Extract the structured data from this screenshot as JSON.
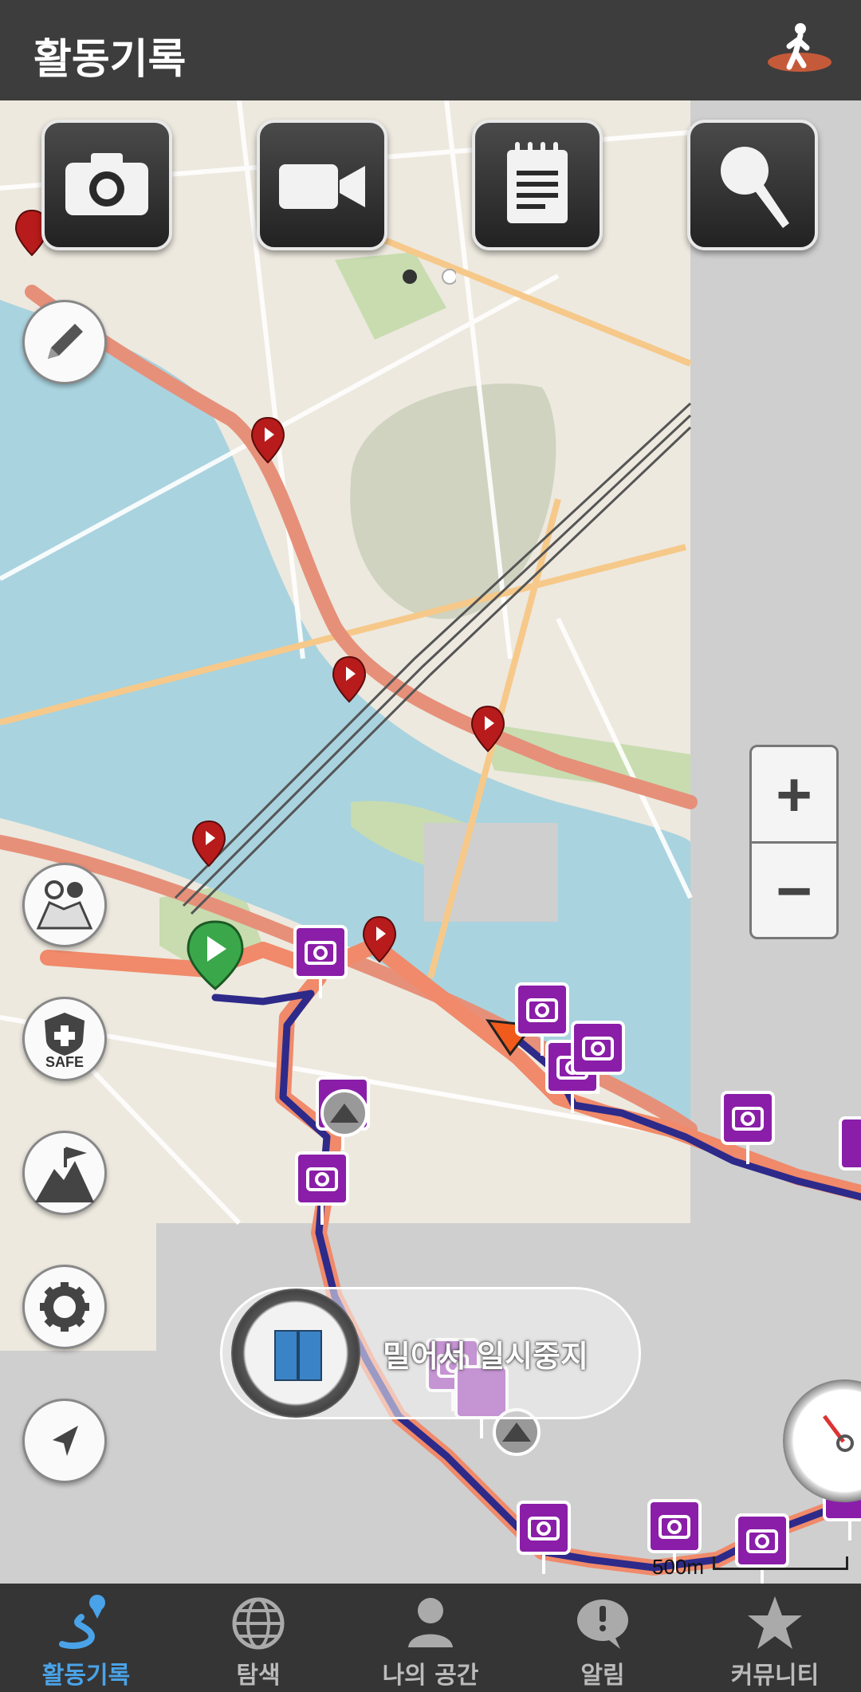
{
  "header": {
    "title": "활동기록",
    "activity_icon": "walker-icon"
  },
  "media_buttons": [
    {
      "name": "camera-button",
      "icon": "camera-icon"
    },
    {
      "name": "video-button",
      "icon": "video-camera-icon"
    },
    {
      "name": "memo-button",
      "icon": "notepad-icon"
    },
    {
      "name": "voice-button",
      "icon": "microphone-icon"
    }
  ],
  "map": {
    "zoom_in_label": "+",
    "zoom_out_label": "−",
    "scale_label": "500m",
    "pause_slider_label": "밀어서 일시중지",
    "colors": {
      "water": "#a9d3df",
      "land": "#ede9df",
      "park": "#c8dcb0",
      "track": "#2d2a8a",
      "track_halo": "#f08a6a",
      "photo_pin": "#8a1ea8",
      "marker": "#b81b1b"
    }
  },
  "side_buttons": [
    {
      "name": "edit-button",
      "icon": "pencil-icon"
    },
    {
      "name": "share-map-button",
      "icon": "people-map-icon"
    },
    {
      "name": "safe-button",
      "icon": "shield-icon",
      "label": "SAFE"
    },
    {
      "name": "summit-button",
      "icon": "mountain-flag-icon"
    },
    {
      "name": "settings-button",
      "icon": "gear-icon"
    },
    {
      "name": "my-location-button",
      "icon": "navigation-arrow-icon"
    }
  ],
  "bottom_nav": [
    {
      "label": "활동기록",
      "icon": "route-pin-icon",
      "active": true
    },
    {
      "label": "탐색",
      "icon": "globe-icon",
      "active": false
    },
    {
      "label": "나의 공간",
      "icon": "person-icon",
      "active": false
    },
    {
      "label": "알림",
      "icon": "alert-bubble-icon",
      "active": false
    },
    {
      "label": "커뮤니티",
      "icon": "star-icon",
      "active": false
    }
  ]
}
